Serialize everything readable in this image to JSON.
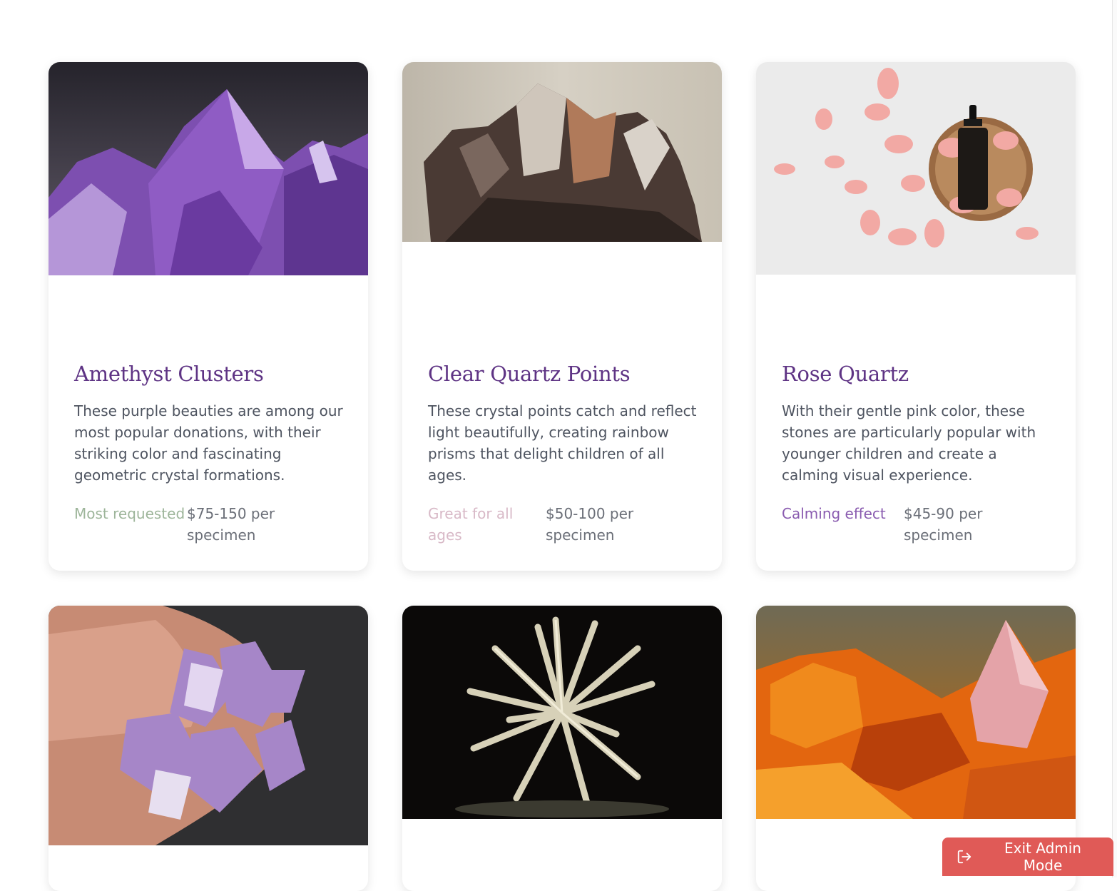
{
  "cards": [
    {
      "title": "Amethyst Clusters",
      "description": "These purple beauties are among our most popular donations, with their striking color and fascinating geometric crystal formations.",
      "tag": "Most requested",
      "tag_color": "#9db59a",
      "price": "$75-150 per specimen",
      "image": "amethyst-cluster-photo"
    },
    {
      "title": "Clear Quartz Points",
      "description": "These crystal points catch and reflect light beautifully, creating rainbow prisms that delight children of all ages.",
      "tag": "Great for all ages",
      "tag_color": "#d8b9c7",
      "price": "$50-100 per specimen",
      "image": "clear-quartz-photo"
    },
    {
      "title": "Rose Quartz",
      "description": "With their gentle pink color, these stones are particularly popular with younger children and create a calming visual experience.",
      "tag": "Calming effect",
      "tag_color": "#8a5cb0",
      "price": "$45-90 per specimen",
      "image": "rose-petals-oil-bottle-photo"
    },
    {
      "image": "amethyst-points-in-hand-photo"
    },
    {
      "image": "selenite-cluster-photo"
    },
    {
      "image": "citrine-cluster-photo"
    }
  ],
  "admin": {
    "exit_label": "Exit Admin Mode",
    "icon": "logout-icon",
    "color": "#e05a57"
  }
}
